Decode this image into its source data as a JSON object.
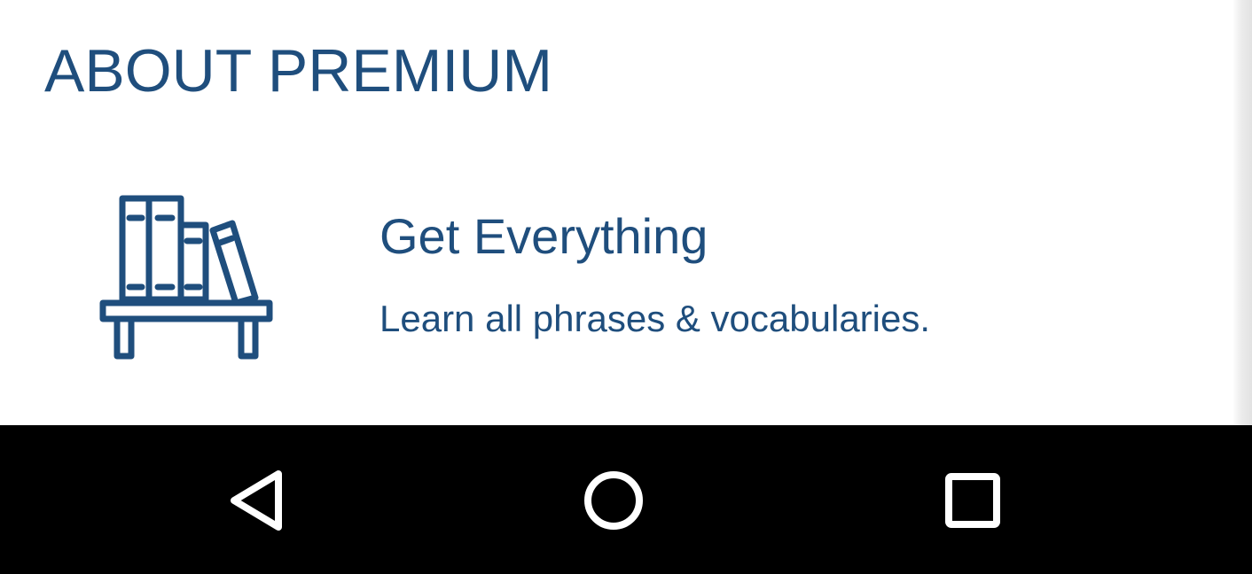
{
  "section": {
    "title": "ABOUT PREMIUM"
  },
  "feature": {
    "icon": "bookshelf-icon",
    "title": "Get Everything",
    "description": "Learn all phrases & vocabularies."
  },
  "navbar": {
    "back_icon": "back-triangle-icon",
    "home_icon": "home-circle-icon",
    "recents_icon": "recents-square-icon"
  },
  "colors": {
    "accent": "#1f4e7d",
    "background": "#ffffff",
    "navbar": "#000000",
    "nav_icon": "#ffffff"
  }
}
